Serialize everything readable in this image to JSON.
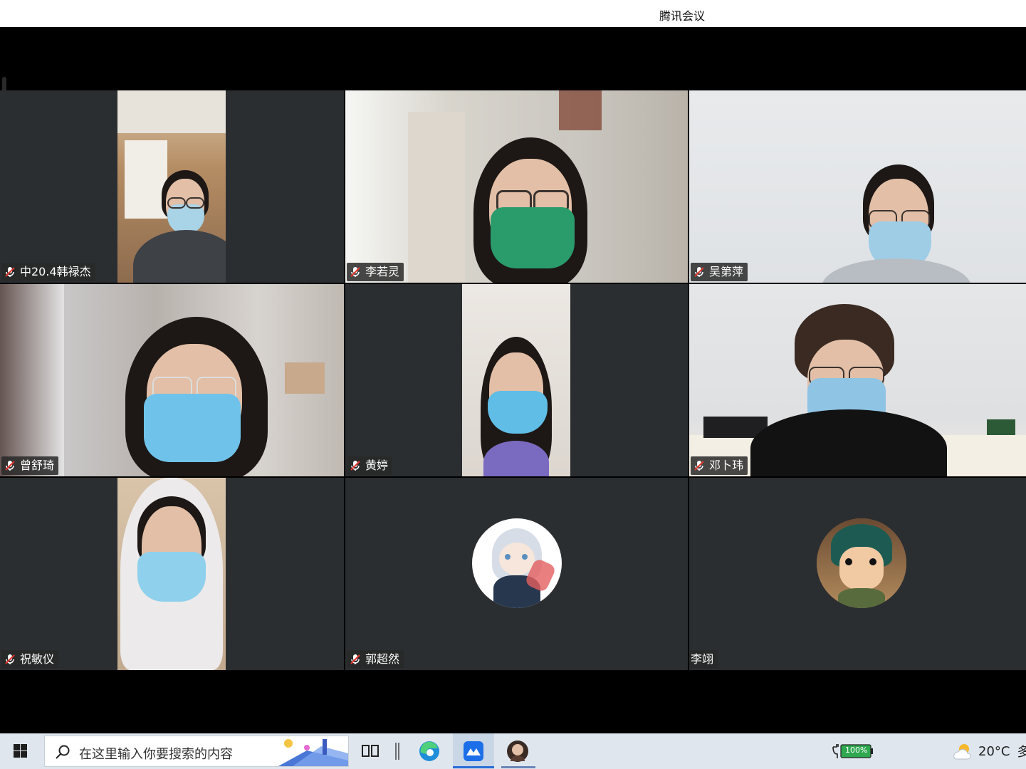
{
  "window": {
    "title": "腾讯会议"
  },
  "participants": [
    {
      "name": "中20.4韩禄杰",
      "muted": true
    },
    {
      "name": "李若灵",
      "muted": true
    },
    {
      "name": "吴第萍",
      "muted": true
    },
    {
      "name": "曾舒琦",
      "muted": true
    },
    {
      "name": "黄婷",
      "muted": true
    },
    {
      "name": "邓卜玮",
      "muted": true
    },
    {
      "name": "祝敏仪",
      "muted": true
    },
    {
      "name": "郭超然",
      "muted": true
    },
    {
      "name": "李翊",
      "muted": false
    }
  ],
  "taskbar": {
    "search_placeholder": "在这里输入你要搜索的内容",
    "battery_label": "100%",
    "temperature": "20°C",
    "overflow_text": "多"
  },
  "colors": {
    "accent": "#e8843a",
    "tile_bg": "#2b2e31",
    "taskbar_bg": "#dfe6ee",
    "highlight": "#2d6fd6",
    "battery_green": "#2fa84f"
  }
}
